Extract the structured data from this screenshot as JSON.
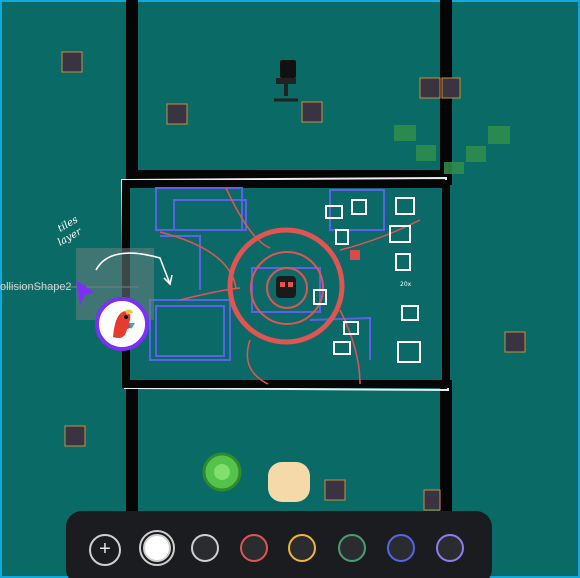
{
  "canvas": {
    "background": "#0a6b66",
    "node_label": "ollisionShape2",
    "annotation_line1": "tiles",
    "annotation_line2": "layer",
    "tag_text": "20x",
    "accent": "#11a8e0"
  },
  "toolbar": {
    "add_label": "+",
    "add_icon": "plus-icon",
    "colors": [
      {
        "name": "white",
        "fill": "#ffffff",
        "ring": "#cfcfcf",
        "active": true
      },
      {
        "name": "light-gray",
        "fill": "#2b2c2f",
        "ring": "#cfcfcf",
        "active": false
      },
      {
        "name": "red",
        "fill": "#2b2c2f",
        "ring": "#e05552",
        "active": false
      },
      {
        "name": "yellow",
        "fill": "#2b2c2f",
        "ring": "#f2b636",
        "active": false
      },
      {
        "name": "green",
        "fill": "#2b2c2f",
        "ring": "#4e9c74",
        "active": false
      },
      {
        "name": "blue",
        "fill": "#2b2c2f",
        "ring": "#5a63e8",
        "active": false
      },
      {
        "name": "purple",
        "fill": "#2b2c2f",
        "ring": "#8c7ef0",
        "active": false
      }
    ]
  },
  "cursor": {
    "color": "#7b2ff7",
    "icon": "pointer-cursor-icon"
  },
  "avatar": {
    "ring": "#7b2ff7",
    "icon": "parrot-avatar-icon"
  }
}
